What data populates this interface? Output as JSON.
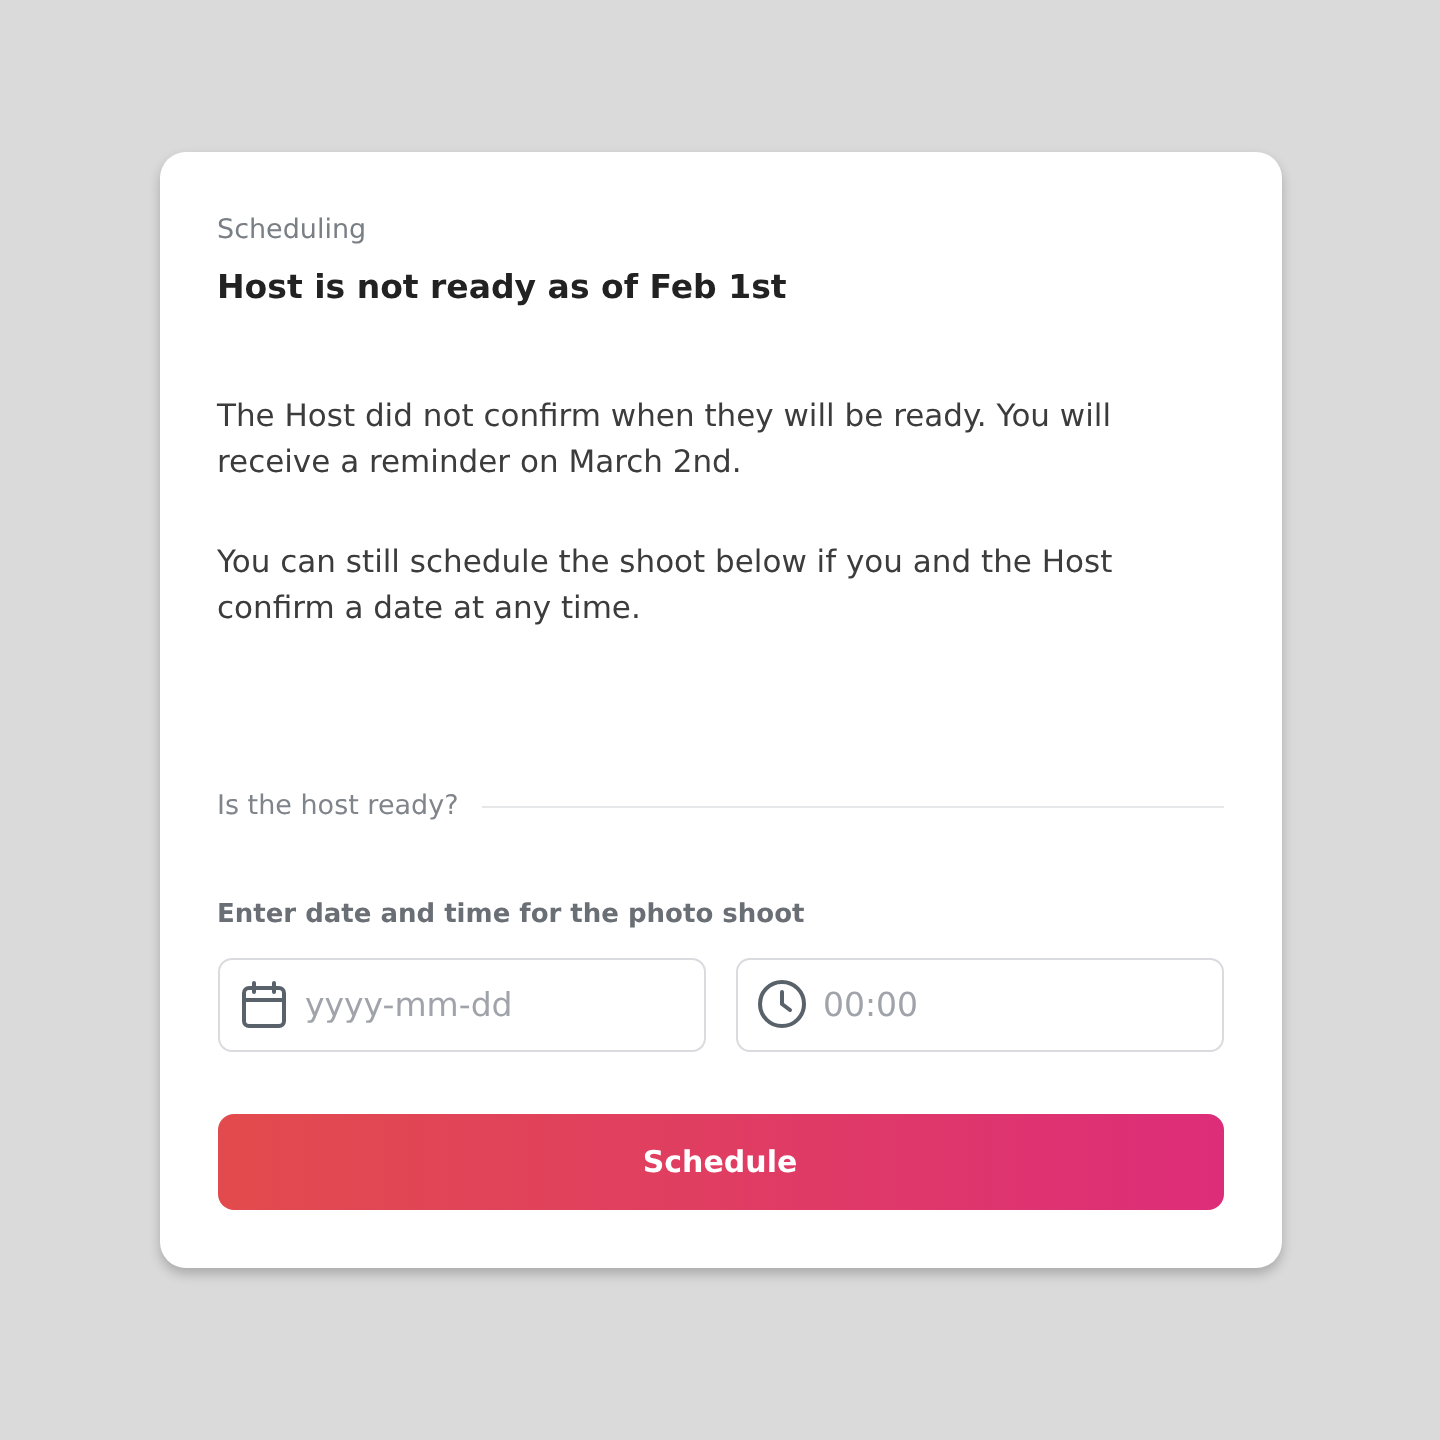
{
  "card": {
    "eyebrow": "Scheduling",
    "title": "Host is not ready as of Feb 1st",
    "paragraphs": [
      "The Host did not confirm when they will be ready. You will receive a reminder on March 2nd.",
      "You can still schedule the shoot below if you and the Host confirm a date at any time."
    ],
    "divider_label": "Is the host ready?",
    "form": {
      "label": "Enter date and time for the photo shoot",
      "fields": [
        {
          "kind": "date",
          "placeholder": "yyyy-mm-dd"
        },
        {
          "kind": "time",
          "placeholder": "00:00"
        }
      ]
    },
    "button": {
      "label": "Schedule"
    }
  }
}
